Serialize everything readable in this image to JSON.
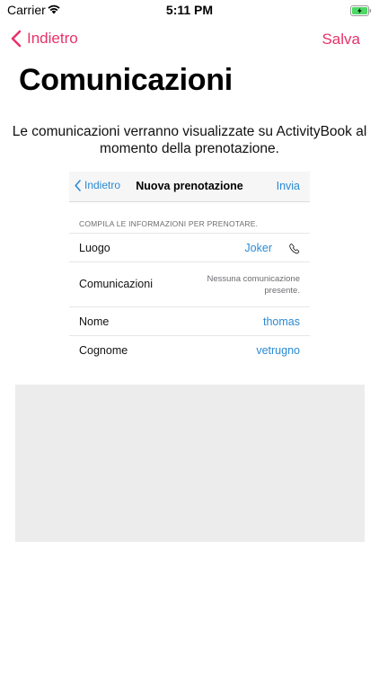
{
  "status_bar": {
    "carrier": "Carrier",
    "time": "5:11 PM",
    "wifi_icon": "wifi-icon",
    "battery_icon": "battery-charging-icon"
  },
  "nav": {
    "back_label": "Indietro",
    "save_label": "Salva",
    "accent_color": "#e8326a"
  },
  "page": {
    "title": "Comunicazioni",
    "description": "Le comunicazioni verranno visualizzate su ActivityBook al momento della prenotazione."
  },
  "preview": {
    "nav": {
      "back_label": "Indietro",
      "title": "Nuova prenotazione",
      "send_label": "Invia"
    },
    "section_header": "COMPILA LE INFORMAZIONI PER PRENOTARE.",
    "rows": [
      {
        "label": "Luogo",
        "value": "Joker",
        "icon": "phone-icon"
      },
      {
        "label": "Comunicazioni",
        "note": "Nessuna comunicazione presente."
      },
      {
        "label": "Nome",
        "value": "thomas"
      },
      {
        "label": "Cognome",
        "value": "vetrugno"
      }
    ],
    "link_color": "#2a8ad4"
  }
}
